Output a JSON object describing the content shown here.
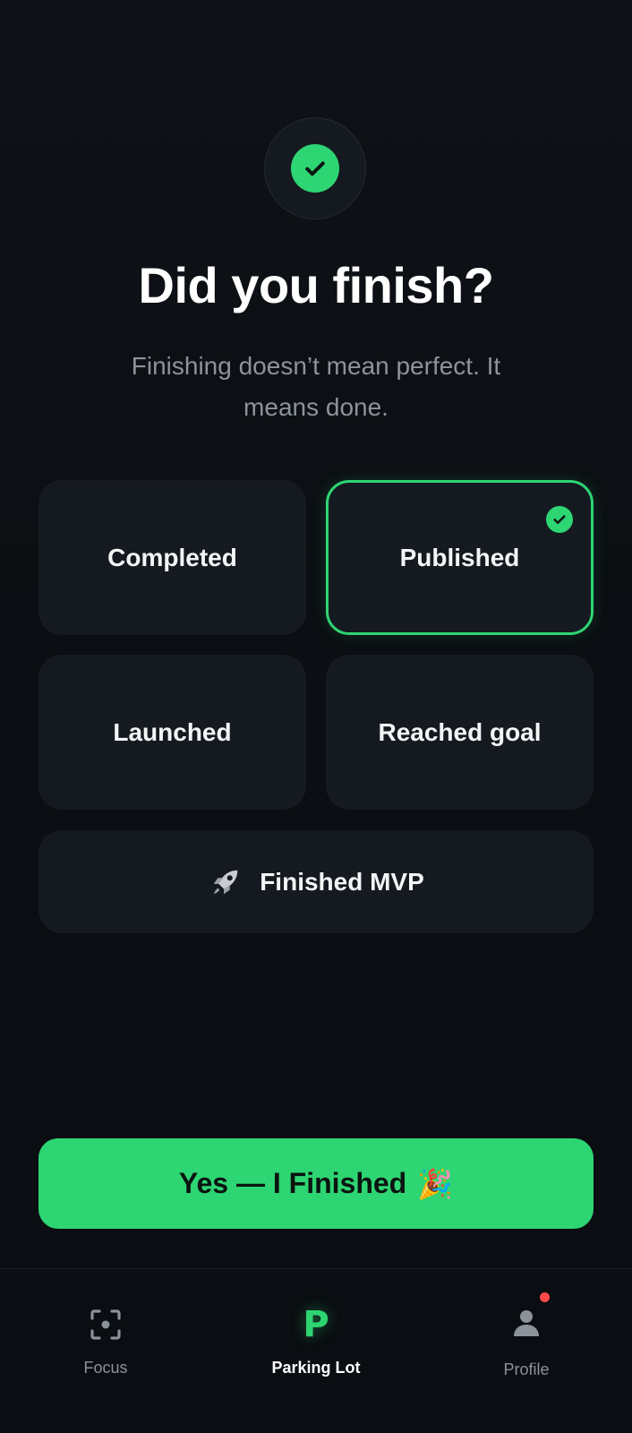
{
  "header": {
    "title": "Did you finish?",
    "subtitle": "Finishing doesn’t mean perfect. It means done."
  },
  "options": [
    {
      "label": "Completed",
      "selected": false
    },
    {
      "label": "Published",
      "selected": true
    },
    {
      "label": "Launched",
      "selected": false
    },
    {
      "label": "Reached goal",
      "selected": false
    },
    {
      "label": "Finished MVP",
      "icon": "rocket-icon",
      "selected": false
    }
  ],
  "cta": {
    "label": "Yes — I Finished",
    "emoji": "🎉"
  },
  "nav": {
    "items": [
      {
        "label": "Focus",
        "icon": "focus-icon",
        "active": false
      },
      {
        "label": "Parking Lot",
        "icon": "parking-p-icon",
        "active": true
      },
      {
        "label": "Profile",
        "icon": "user-icon",
        "active": false,
        "notification": true
      }
    ]
  },
  "colors": {
    "accent": "#2ed573",
    "background": "#0b0e12",
    "card": "#151a20",
    "muted_text": "#8d939b",
    "notification": "#ff4a4a"
  }
}
